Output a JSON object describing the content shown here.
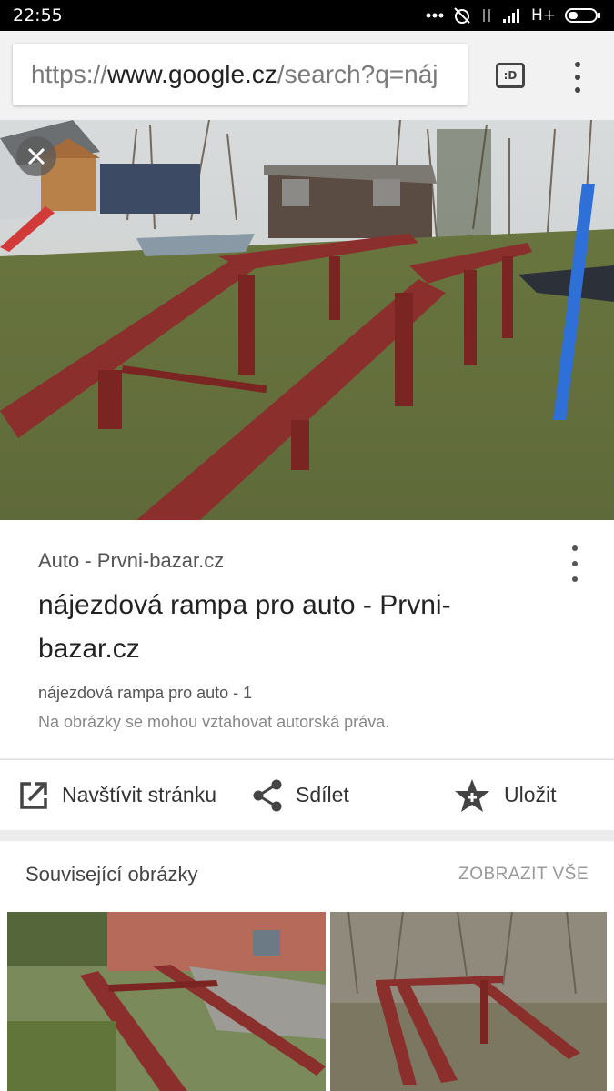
{
  "status": {
    "time": "22:55",
    "network": "H+"
  },
  "browser": {
    "url_prefix": "https://",
    "url_host": "www.google.cz",
    "url_path": "/search?q=náj",
    "tabs_label": ":D"
  },
  "result": {
    "source": "Auto - Prvni-bazar.cz",
    "title": "nájezdová rampa pro auto - Prvni-bazar.cz",
    "description": "nájezdová rampa pro auto - 1",
    "copyright": "Na obrázky se mohou vztahovat autorská práva."
  },
  "actions": {
    "visit": "Navštívit stránku",
    "share": "Sdílet",
    "save": "Uložit"
  },
  "related": {
    "title": "Související obrázky",
    "show_all": "ZOBRAZIT VŠE"
  },
  "colors": {
    "ramp": "#8a2f2c",
    "grass": "#6f7c46",
    "accent_blue": "#2f6fd8"
  }
}
